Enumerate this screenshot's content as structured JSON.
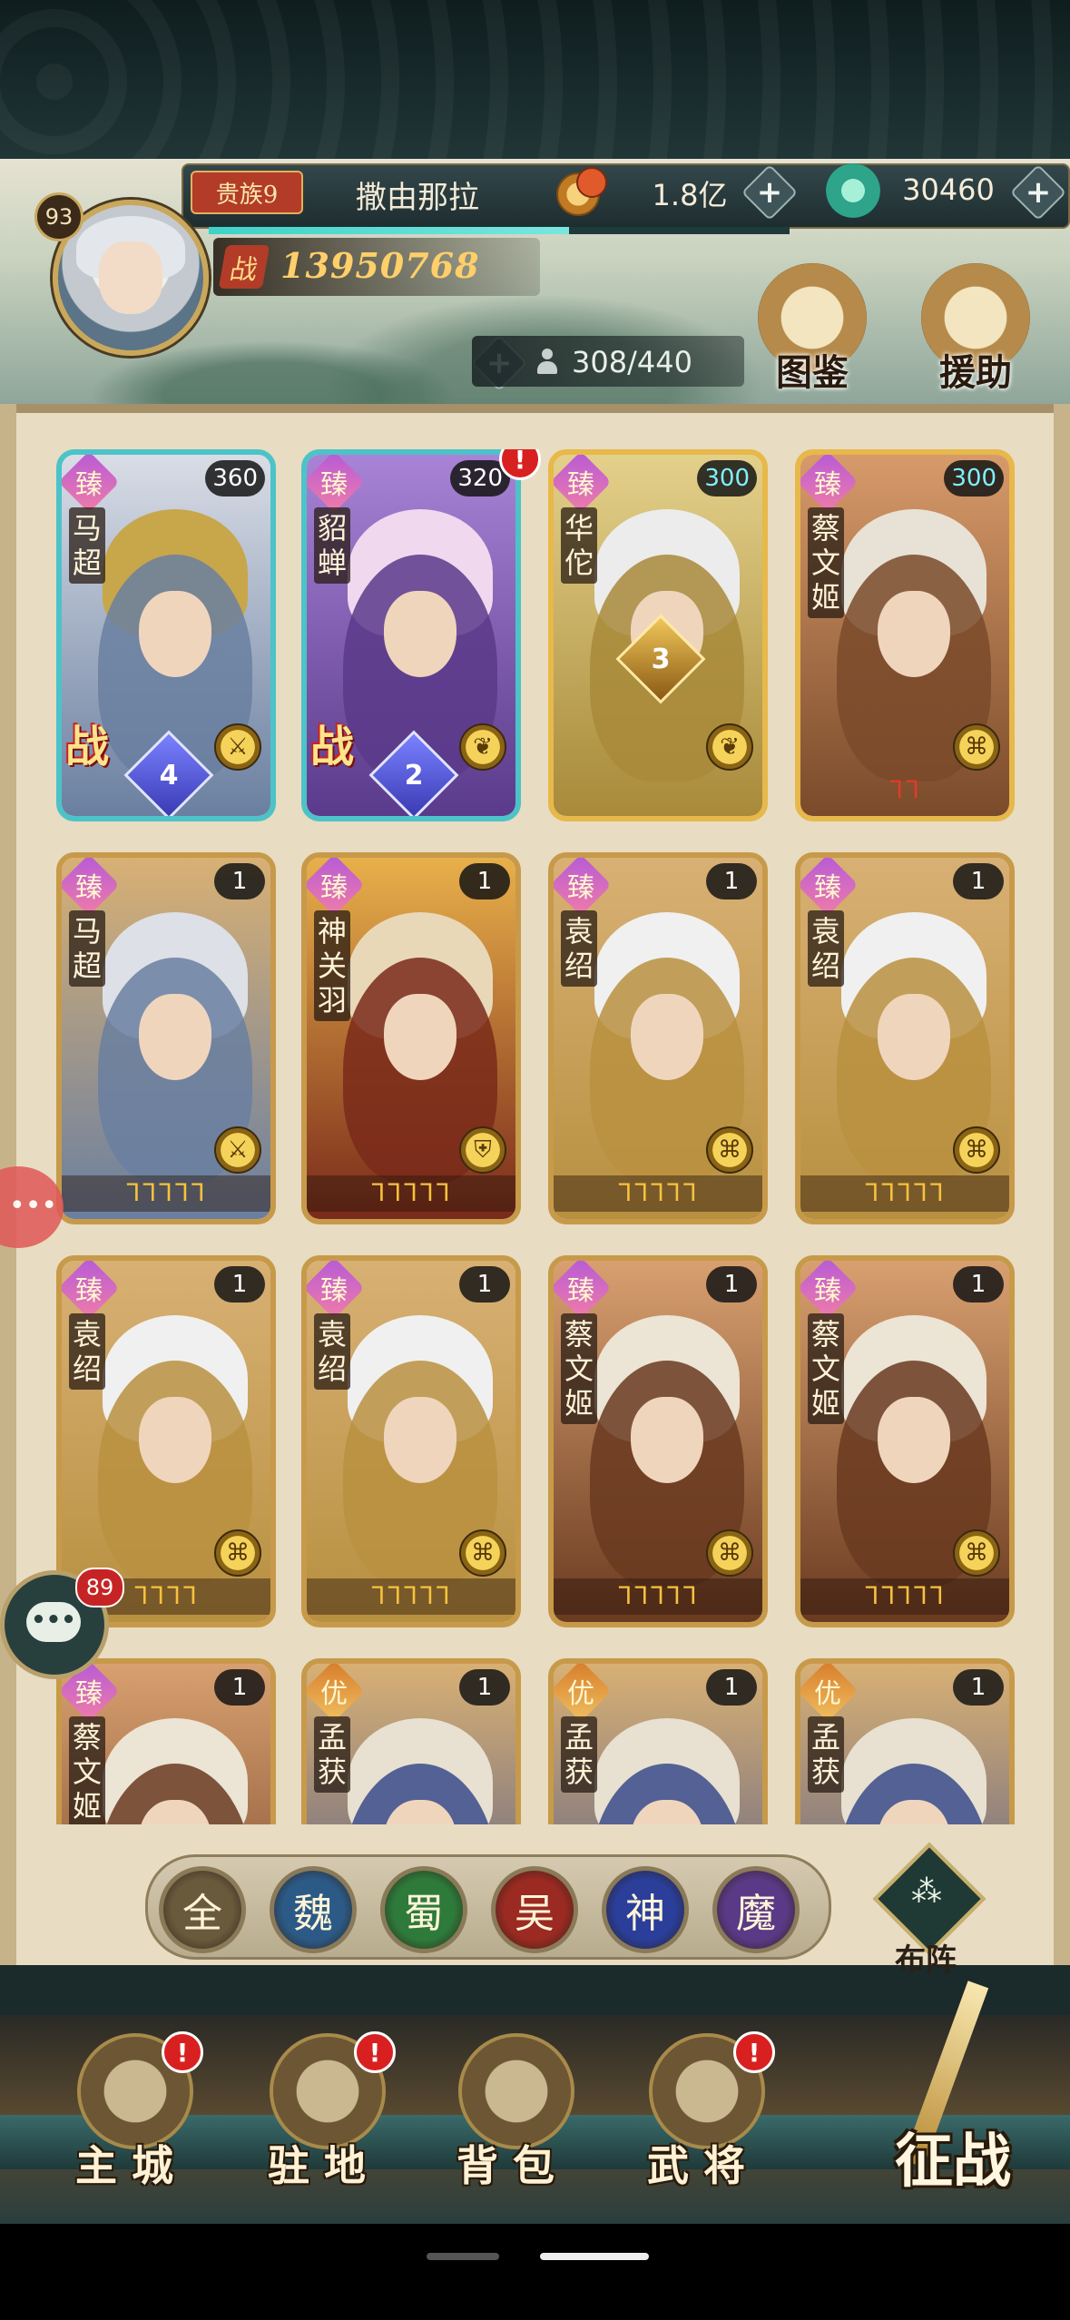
{
  "player": {
    "level": "93",
    "vip": "贵族9",
    "name": "撒由那拉",
    "power": "13950768",
    "exp_fraction": 0.62
  },
  "currency": {
    "gold": "1.8亿",
    "jade": "30460",
    "plus_symbol": "+"
  },
  "roster": {
    "capacity": "308/440"
  },
  "top_buttons": {
    "codex": "图鉴",
    "support": "援助"
  },
  "heroes": [
    {
      "rank": "臻",
      "name": "马超",
      "level": "360",
      "level_color": "white",
      "element": "⚔",
      "tag": "战",
      "gem": "4",
      "gem_color": "blue",
      "frame": "ur",
      "palette": [
        "#d9dde6",
        "#6a7fa0",
        "#c8a64a"
      ]
    },
    {
      "rank": "臻",
      "name": "貂蝉",
      "level": "320",
      "level_color": "white",
      "element": "❦",
      "tag": "战",
      "gem": "2",
      "gem_color": "blue",
      "frame": "ur",
      "alert": "!",
      "palette": [
        "#a883d6",
        "#5a3a8a",
        "#f0d8ef"
      ]
    },
    {
      "rank": "臻",
      "name": "华佗",
      "level": "300",
      "level_color": "cyan",
      "element": "❦",
      "gem": "3",
      "gem_color": "gold",
      "frame": "ssr",
      "palette": [
        "#e3d08a",
        "#a88a3a",
        "#ececec"
      ]
    },
    {
      "rank": "臻",
      "name": "蔡文姬",
      "level": "300",
      "level_color": "cyan",
      "element": "⌘",
      "flames": "ᒣᒣ",
      "flames_color": "red",
      "frame": "ssr",
      "palette": [
        "#d79a6a",
        "#7a4a2a",
        "#e8e2d6"
      ]
    },
    {
      "rank": "臻",
      "name": "马超",
      "level": "1",
      "element": "⚔",
      "flames": "ᒣᒣᒣᒣᒣ",
      "frame": "gold",
      "palette": [
        "#d8b074",
        "#6a7fa0",
        "#dde0e6"
      ]
    },
    {
      "rank": "臻",
      "name": "神关羽",
      "level": "1",
      "element": "⛨",
      "flames": "ᒣᒣᒣᒣᒣ",
      "frame": "gold",
      "palette": [
        "#e8b04a",
        "#7a2a1a",
        "#e8d8b8"
      ]
    },
    {
      "rank": "臻",
      "name": "袁绍",
      "level": "1",
      "element": "⌘",
      "flames": "ᒣᒣᒣᒣᒣ",
      "frame": "gold",
      "palette": [
        "#d8b074",
        "#b89040",
        "#f0f0f0"
      ]
    },
    {
      "rank": "臻",
      "name": "袁绍",
      "level": "1",
      "element": "⌘",
      "flames": "ᒣᒣᒣᒣᒣ",
      "frame": "gold",
      "palette": [
        "#d8b074",
        "#b89040",
        "#f0f0f0"
      ]
    },
    {
      "rank": "臻",
      "name": "袁绍",
      "level": "1",
      "element": "⌘",
      "flames": "ᒣᒣᒣᒣ",
      "frame": "gold",
      "palette": [
        "#d8b074",
        "#b89040",
        "#f0f0f0"
      ]
    },
    {
      "rank": "臻",
      "name": "袁绍",
      "level": "1",
      "element": "⌘",
      "flames": "ᒣᒣᒣᒣᒣ",
      "frame": "gold",
      "palette": [
        "#d8b074",
        "#b89040",
        "#f0f0f0"
      ]
    },
    {
      "rank": "臻",
      "name": "蔡文姬",
      "level": "1",
      "element": "⌘",
      "flames": "ᒣᒣᒣᒣᒣ",
      "frame": "gold",
      "palette": [
        "#d8a070",
        "#6a3a20",
        "#ece4d4"
      ]
    },
    {
      "rank": "臻",
      "name": "蔡文姬",
      "level": "1",
      "element": "⌘",
      "flames": "ᒣᒣᒣᒣᒣ",
      "frame": "gold",
      "palette": [
        "#d8a070",
        "#6a3a20",
        "#ece4d4"
      ]
    },
    {
      "rank": "臻",
      "name": "蔡文姬",
      "level": "1",
      "element": "",
      "frame": "gold",
      "palette": [
        "#d8a070",
        "#6a3a20",
        "#ece4d4"
      ]
    },
    {
      "rank": "优",
      "name": "孟获",
      "level": "1",
      "element": "",
      "frame": "gold",
      "rank_style": "you",
      "palette": [
        "#d8b074",
        "#3a4a8a",
        "#e8e0d0"
      ]
    },
    {
      "rank": "优",
      "name": "孟获",
      "level": "1",
      "element": "",
      "frame": "gold",
      "rank_style": "you",
      "palette": [
        "#d8b074",
        "#3a4a8a",
        "#e8e0d0"
      ]
    },
    {
      "rank": "优",
      "name": "孟获",
      "level": "1",
      "element": "",
      "frame": "gold",
      "rank_style": "you",
      "palette": [
        "#d8b074",
        "#3a4a8a",
        "#e8e0d0"
      ]
    }
  ],
  "filters": [
    {
      "label": "全",
      "color": "#6a5a3c"
    },
    {
      "label": "魏",
      "color": "#2c5a86"
    },
    {
      "label": "蜀",
      "color": "#2e7a3a"
    },
    {
      "label": "吴",
      "color": "#9a2a22"
    },
    {
      "label": "神",
      "color": "#2a3e9a"
    },
    {
      "label": "魔",
      "color": "#5a3a86"
    }
  ],
  "formation_label": "布阵",
  "nav": [
    {
      "label": "主城",
      "alert": "!"
    },
    {
      "label": "驻地",
      "alert": "!"
    },
    {
      "label": "背包",
      "alert": ""
    },
    {
      "label": "武将",
      "alert": "!"
    }
  ],
  "campaign_label": "征战",
  "chat": {
    "count": "89",
    "glyph": "•••"
  },
  "icons": {
    "power": "战",
    "side_widget": "•••",
    "person": "person-icon",
    "gold": "coin-stack-icon",
    "jade": "jade-dragon-icon"
  }
}
